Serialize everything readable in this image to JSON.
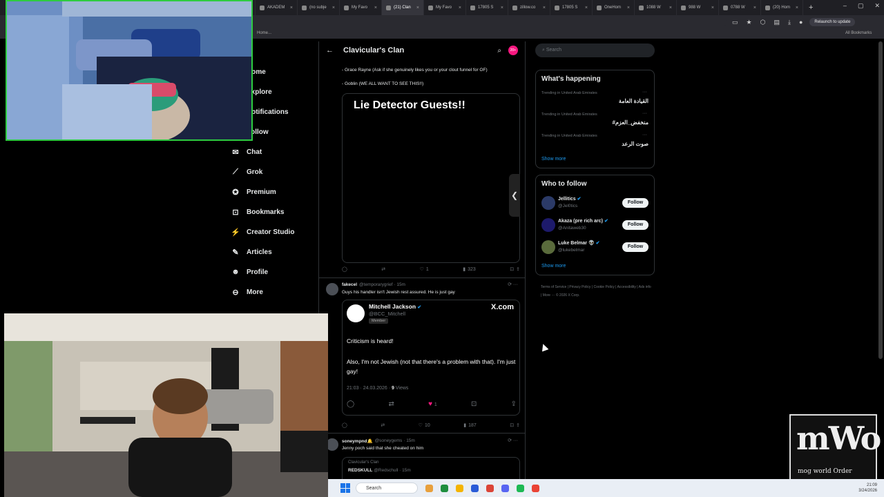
{
  "browser": {
    "tabs": [
      {
        "label": "",
        "active": false
      },
      {
        "label": "AKADEM",
        "active": false
      },
      {
        "label": "(no subje",
        "active": false
      },
      {
        "label": "My Favo",
        "active": false
      },
      {
        "label": "(21) Clan",
        "active": true
      },
      {
        "label": "My Favo",
        "active": false
      },
      {
        "label": "17805 S",
        "active": false
      },
      {
        "label": "zillow.co",
        "active": false
      },
      {
        "label": "17805 S",
        "active": false
      },
      {
        "label": "OneHom",
        "active": false
      },
      {
        "label": "1088 W",
        "active": false
      },
      {
        "label": "988 W",
        "active": false
      },
      {
        "label": "0788 W",
        "active": false
      },
      {
        "label": "(20) Hom",
        "active": false
      }
    ],
    "new_tab": "+",
    "relaunch_label": "Relaunch to update",
    "bookmark_left": "Home...",
    "bookmark_right": "All Bookmarks"
  },
  "nav": [
    {
      "icon": "home-icon",
      "glyph": "⌂",
      "label": "Home"
    },
    {
      "icon": "explore-icon",
      "glyph": "⌕",
      "label": "Explore"
    },
    {
      "icon": "bell-icon",
      "glyph": "♪",
      "label": "Notifications"
    },
    {
      "icon": "follow-icon",
      "glyph": "☺",
      "label": "Follow"
    },
    {
      "icon": "chat-icon",
      "glyph": "✉",
      "label": "Chat"
    },
    {
      "icon": "grok-icon",
      "glyph": "⟋",
      "label": "Grok"
    },
    {
      "icon": "premium-icon",
      "glyph": "✪",
      "label": "Premium"
    },
    {
      "icon": "bookmark-icon",
      "glyph": "⊡",
      "label": "Bookmarks"
    },
    {
      "icon": "creator-icon",
      "glyph": "⚡",
      "label": "Creator Studio"
    },
    {
      "icon": "articles-icon",
      "glyph": "✎",
      "label": "Articles"
    },
    {
      "icon": "profile-icon",
      "glyph": "☻",
      "label": "Profile"
    },
    {
      "icon": "more-icon",
      "glyph": "⊖",
      "label": "More"
    }
  ],
  "feed": {
    "title": "Clavicular's Clan",
    "notif_count": "20+",
    "line1": "- Grace Rayne (Ask if she genuinely likes you or your clout funnel for OF)",
    "line2": "- Goblin (WE ALL WANT TO SEE THIS!!)",
    "image_text": "Lie Detector Guests!!",
    "post1_actions": {
      "reply": "",
      "repost": "",
      "like": "1",
      "views": "323"
    },
    "post2": {
      "name": "fakecel",
      "handle": "@temporarygrief · 15m",
      "text": "Guys his handler isn't Jewish rest assured. He is just gay",
      "quote": {
        "name": "Mitchell Jackson",
        "handle": "@BCC_Mitchell",
        "badge": "Member",
        "logo": "X.com",
        "p1": "Criticism is heard!",
        "p2": "Also, I'm not Jewish (not that there's a problem with that). I'm just gay!",
        "meta_time": "21:03 · 24.03.2026 · ",
        "meta_views_n": "9",
        "meta_views_label": " Views",
        "likes": "1"
      },
      "actions": {
        "reply": "",
        "repost": "",
        "like": "10",
        "views": "187"
      }
    },
    "post3": {
      "name": "soneympnd🔔",
      "handle": "@soneygems · 15m",
      "text": "Jenny poch said that she cheated on him",
      "inner_community": "Clavicular's Clan",
      "inner_name": "REDSKULL",
      "inner_handle": "@Redschull · 15m"
    }
  },
  "right": {
    "search_placeholder": "Search",
    "happening_title": "What's happening",
    "trends": [
      {
        "meta": "Trending in United Arab Emirates",
        "name": "القيادة العامة"
      },
      {
        "meta": "Trending in United Arab Emirates",
        "name": "#منخفض_العزم"
      },
      {
        "meta": "Trending in United Arab Emirates",
        "name": "صوت الرعد"
      }
    ],
    "show_more": "Show more",
    "who_title": "Who to follow",
    "who": [
      {
        "name": "Jellitics",
        "handle": "@Jel0tics",
        "color": "#2b3a67"
      },
      {
        "name": "Akaza (pre rich arc)",
        "handle": "@Anitaweb30",
        "color": "#1d1a6b"
      },
      {
        "name": "Luke Belmar 👽",
        "handle": "@lukebelmar",
        "color": "#5a6b3c"
      }
    ],
    "follow_label": "Follow",
    "footer": "Terms of Service | Privacy Policy | Cookie Policy | Accessibility | Ads info | More ··· © 2026 X Corp."
  },
  "overlay": {
    "logo_big": "mWo",
    "logo_sub": "mog world Order"
  },
  "taskbar": {
    "search_placeholder": "Search",
    "clock_time": "21:09",
    "clock_date": "3/24/2026"
  },
  "colors": {
    "accent": "#1d9bf0",
    "like": "#f91880",
    "webcam_border": "#2ecc40"
  }
}
